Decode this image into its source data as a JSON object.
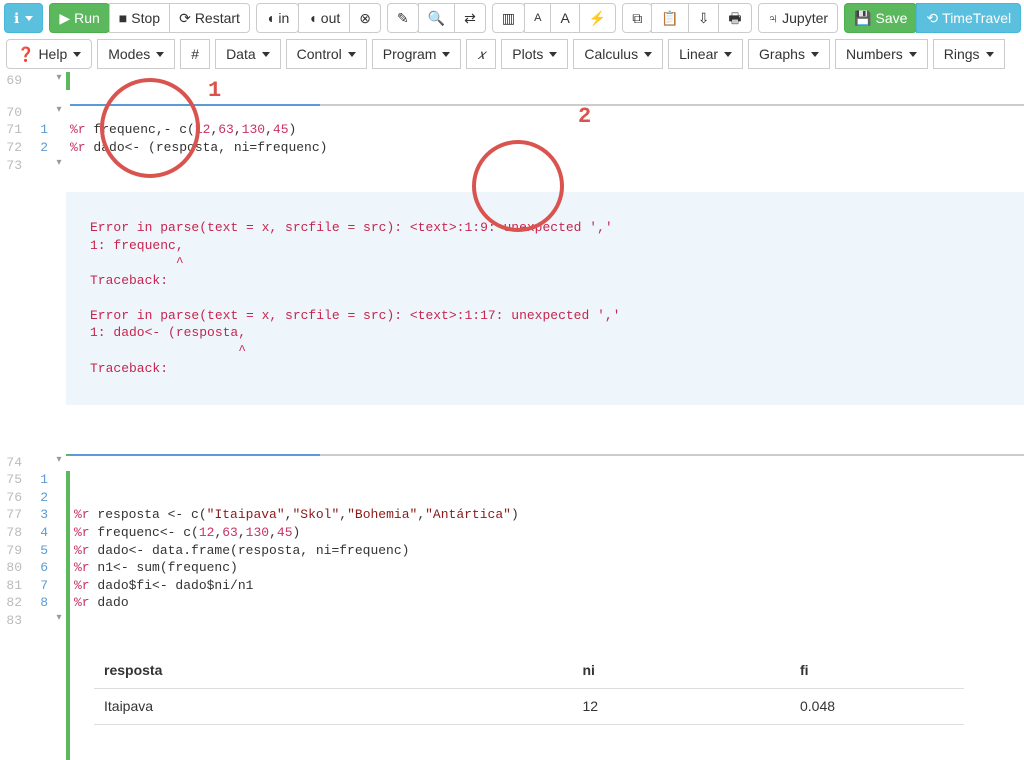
{
  "toolbar": {
    "run": "Run",
    "stop": "Stop",
    "restart": "Restart",
    "in": "in",
    "out": "out",
    "jupyter": "Jupyter",
    "save": "Save",
    "timetravel": "TimeTravel"
  },
  "menubar": {
    "help": "Help",
    "modes": "Modes",
    "hash": "#",
    "data": "Data",
    "control": "Control",
    "program": "Program",
    "xvar": "𝑥",
    "plots": "Plots",
    "calculus": "Calculus",
    "linear": "Linear",
    "graphs": "Graphs",
    "numbers": "Numbers",
    "rings": "Rings"
  },
  "annot": {
    "one": "1",
    "two": "2"
  },
  "lines": {
    "l69": "69",
    "l70": "70",
    "l71": "71",
    "s71": "1",
    "l72": "72",
    "s72": "2",
    "l73": "73",
    "l74": "74",
    "l75": "75",
    "s75": "1",
    "l76": "76",
    "s76": "2",
    "l77": "77",
    "s77": "3",
    "l78": "78",
    "s78": "4",
    "l79": "79",
    "s79": "5",
    "l80": "80",
    "s80": "6",
    "l81": "81",
    "s81": "7",
    "l82": "82",
    "s82": "8",
    "l83": "83"
  },
  "code": {
    "c71": "%r frequenc,- c(12,63,130,45)",
    "c72": "%r dado<- (resposta, ni=frequenc)",
    "c77": "%r resposta <- c(\"Itaipava\",\"Skol\",\"Bohemia\",\"Antártica\")",
    "c78": "%r frequenc<- c(12,63,130,45)",
    "c79": "%r dado<- data.frame(resposta, ni=frequenc)",
    "c80": "%r n1<- sum(frequenc)",
    "c81": "%r dado$fi<- dado$ni/n1",
    "c82": "%r dado"
  },
  "error": {
    "e1": "Error in parse(text = x, srcfile = src): <text>:1:9: unexpected ','",
    "e2": "1: frequenc,",
    "e3": "           ^",
    "tb": "Traceback:",
    "blank": "",
    "e4": "Error in parse(text = x, srcfile = src): <text>:1:17: unexpected ','",
    "e5": "1: dado<- (resposta,",
    "e6": "                   ^"
  },
  "table": {
    "h1": "resposta",
    "h2": "ni",
    "h3": "fi",
    "r1c1": "Itaipava",
    "r1c2": "12",
    "r1c3": "0.048"
  }
}
